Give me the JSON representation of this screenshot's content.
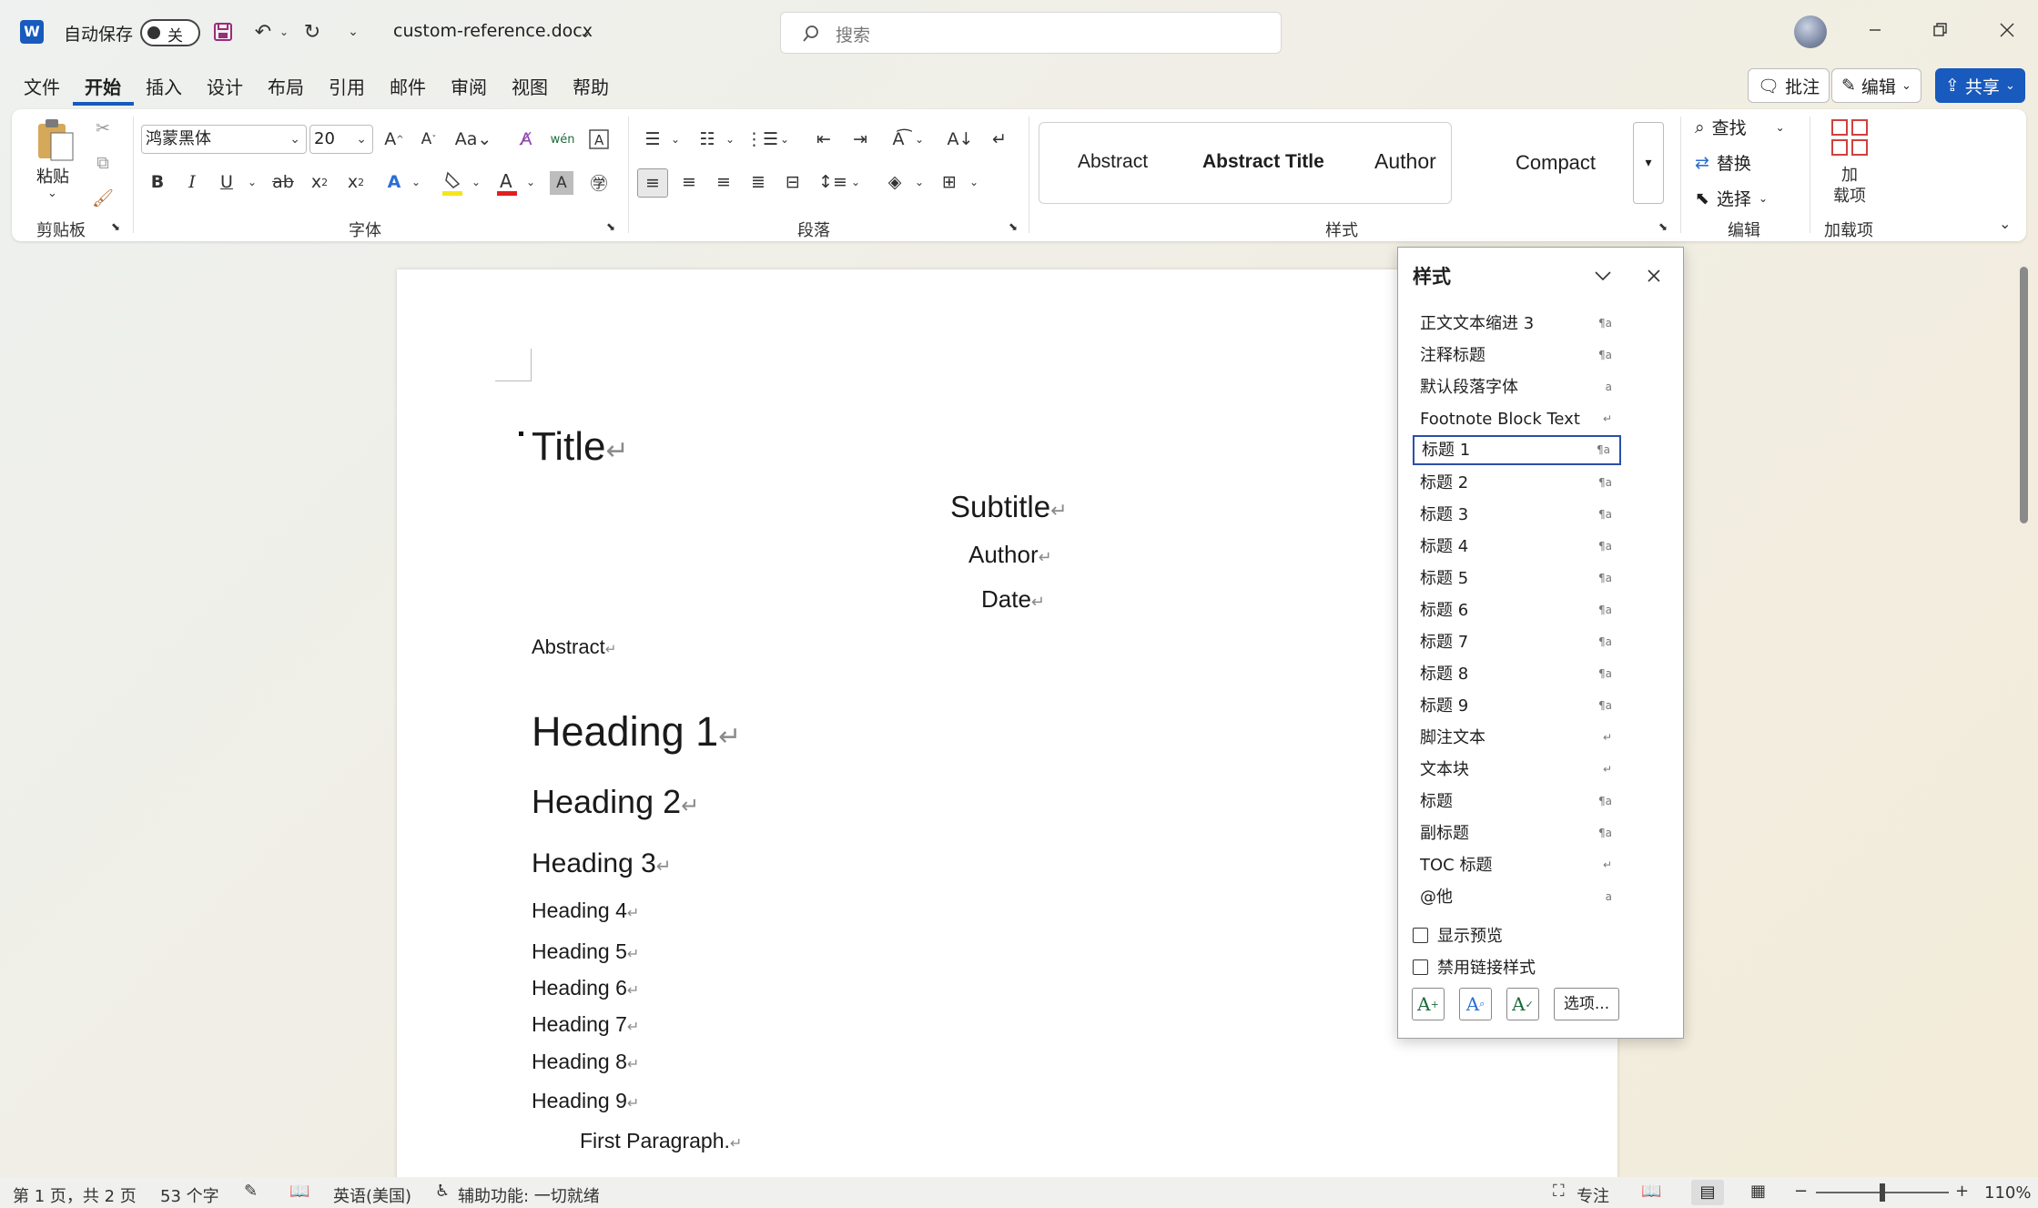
{
  "titlebar": {
    "app_icon": "W",
    "autosave_label": "自动保存",
    "autosave_state": "关",
    "filename": "custom-reference.docx",
    "search_placeholder": "搜索",
    "icons": [
      "save-icon",
      "undo-icon",
      "redo-icon",
      "customize-icon",
      "minimize-icon",
      "restore-icon",
      "close-icon"
    ]
  },
  "menu": {
    "tabs": [
      "文件",
      "开始",
      "插入",
      "设计",
      "布局",
      "引用",
      "邮件",
      "审阅",
      "视图",
      "帮助"
    ],
    "active": "开始",
    "comment_label": "批注",
    "edit_label": "编辑",
    "share_label": "共享"
  },
  "ribbon": {
    "clipboard": {
      "paste_label": "粘贴",
      "group_label": "剪贴板"
    },
    "font": {
      "font_name": "鸿蒙黑体",
      "font_size": "20",
      "group_label": "字体"
    },
    "paragraph": {
      "group_label": "段落"
    },
    "styles": {
      "gallery": [
        "Abstract",
        "Abstract Title",
        "Author",
        "Compact"
      ],
      "group_label": "样式"
    },
    "editing": {
      "find_label": "查找",
      "replace_label": "替换",
      "select_label": "选择",
      "group_label": "编辑"
    },
    "addins": {
      "label_line1": "加",
      "label_line2": "载项",
      "group_label": "加载项"
    }
  },
  "document": {
    "title": "Title",
    "subtitle": "Subtitle",
    "author": "Author",
    "date": "Date",
    "abstract": "Abstract",
    "headings": [
      "Heading 1",
      "Heading 2",
      "Heading 3",
      "Heading 4",
      "Heading 5",
      "Heading 6",
      "Heading 7",
      "Heading 8",
      "Heading 9"
    ],
    "first_paragraph": "First Paragraph.",
    "para_mark": "↵"
  },
  "style_pane": {
    "title": "样式",
    "items": [
      {
        "label": "正文文本缩进 3",
        "glyph": "¶a"
      },
      {
        "label": "注释标题",
        "glyph": "¶a"
      },
      {
        "label": "默认段落字体",
        "glyph": "a"
      },
      {
        "label": "Footnote Block Text",
        "glyph": "↵"
      },
      {
        "label": "标题 1",
        "glyph": "¶a",
        "selected": true
      },
      {
        "label": "标题 2",
        "glyph": "¶a"
      },
      {
        "label": "标题 3",
        "glyph": "¶a"
      },
      {
        "label": "标题 4",
        "glyph": "¶a"
      },
      {
        "label": "标题 5",
        "glyph": "¶a"
      },
      {
        "label": "标题 6",
        "glyph": "¶a"
      },
      {
        "label": "标题 7",
        "glyph": "¶a"
      },
      {
        "label": "标题 8",
        "glyph": "¶a"
      },
      {
        "label": "标题 9",
        "glyph": "¶a"
      },
      {
        "label": "脚注文本",
        "glyph": "↵"
      },
      {
        "label": "文本块",
        "glyph": "↵"
      },
      {
        "label": "标题",
        "glyph": "¶a"
      },
      {
        "label": "副标题",
        "glyph": "¶a"
      },
      {
        "label": "TOC 标题",
        "glyph": "↵"
      },
      {
        "label": "@他",
        "glyph": "a"
      }
    ],
    "show_preview_label": "显示预览",
    "disable_linked_label": "禁用链接样式",
    "options_label": "选项..."
  },
  "statusbar": {
    "page_info": "第 1 页，共 2 页",
    "word_count": "53 个字",
    "language": "英语(美国)",
    "accessibility": "辅助功能: 一切就绪",
    "focus_label": "专注",
    "zoom": "110%"
  }
}
